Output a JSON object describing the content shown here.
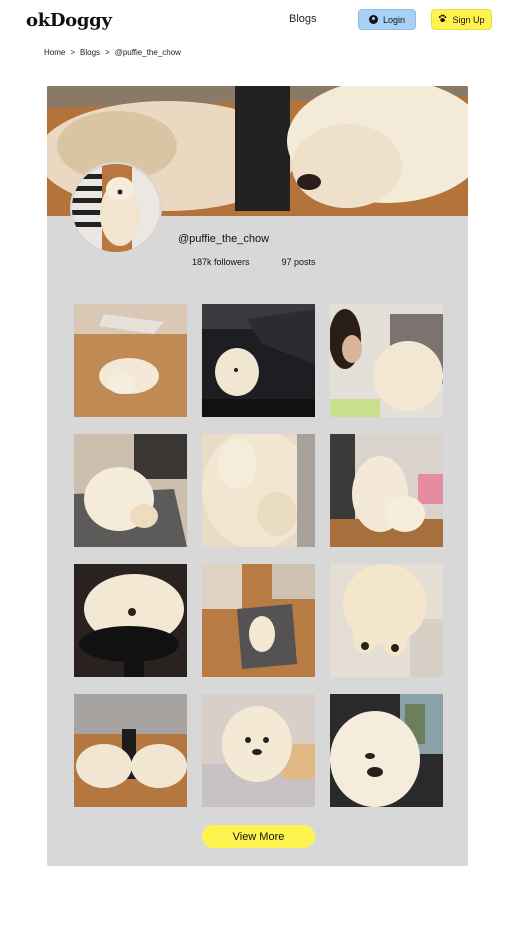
{
  "header": {
    "logo": "okDoggy",
    "nav_blogs": "Blogs",
    "login_label": "Login",
    "signup_label": "Sign Up",
    "login_icon": "user-icon",
    "signup_icon": "paw-icon",
    "colors": {
      "login_bg": "#a9d1f7",
      "signup_bg": "#fff34f",
      "card_bg": "#d8d8d8"
    }
  },
  "breadcrumb": {
    "home": "Home",
    "blogs": "Blogs",
    "current": "@puffie_the_chow",
    "separator": ">"
  },
  "profile": {
    "handle": "@puffie_the_chow",
    "followers": "187k followers",
    "posts": "97 posts"
  },
  "grid": {
    "photos": [
      {
        "name": "photo-puppy-on-wood-floor"
      },
      {
        "name": "photo-puppy-in-car-seat"
      },
      {
        "name": "photo-puppy-with-woman"
      },
      {
        "name": "photo-puppy-on-pee-pad"
      },
      {
        "name": "photo-puppy-fluffy-closeup"
      },
      {
        "name": "photo-puppy-by-wall"
      },
      {
        "name": "photo-puppy-sleeping-on-chair"
      },
      {
        "name": "photo-puppy-on-mat"
      },
      {
        "name": "photo-puppy-paws-up"
      },
      {
        "name": "photo-puppy-under-couch"
      },
      {
        "name": "photo-puppy-on-bed"
      },
      {
        "name": "photo-puppy-in-car-window"
      }
    ]
  },
  "actions": {
    "view_more": "View More"
  }
}
